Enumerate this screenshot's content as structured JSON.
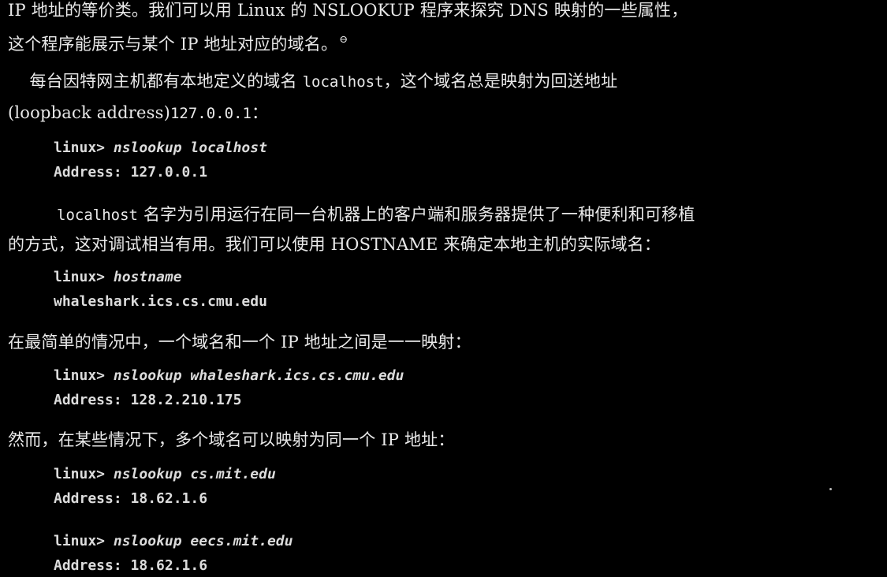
{
  "paragraph_1": {
    "line_1": "IP 地址的等价类。我们可以用 Linux 的 NSLOOKUP 程序来探究 DNS 映射的一些属性，",
    "line_2": "这个程序能展示与某个 IP 地址对应的域名。",
    "footnote_marker": "⊖"
  },
  "paragraph_2": {
    "line_1_prefix": "    每台因特网主机都有本地定义的域名 ",
    "line_1_code": "localhost",
    "line_1_suffix": "，这个域名总是映射为回送地址",
    "line_2_prefix": "(loopback address)",
    "line_2_code": "127.0.0.1",
    "line_2_suffix": "："
  },
  "code_1": {
    "prompt": "linux>",
    "command": "nslookup localhost",
    "output": "Address: 127.0.0.1"
  },
  "paragraph_3": {
    "line_1_code": "localhost",
    "line_1_rest": " 名字为引用运行在同一台机器上的客户端和服务器提供了一种便利和可移植",
    "line_2": "的方式，这对调试相当有用。我们可以使用 HOSTNAME 来确定本地主机的实际域名："
  },
  "code_2": {
    "prompt": "linux>",
    "command": "hostname",
    "output": "whaleshark.ics.cs.cmu.edu"
  },
  "paragraph_4": {
    "line_1": "在最简单的情况中，一个域名和一个 IP 地址之间是一一映射："
  },
  "code_3": {
    "prompt": "linux>",
    "command": "nslookup whaleshark.ics.cs.cmu.edu",
    "output": "Address: 128.2.210.175"
  },
  "paragraph_5": {
    "line_1": "然而，在某些情况下，多个域名可以映射为同一个 IP 地址："
  },
  "code_4": {
    "prompt": "linux>",
    "command": "nslookup cs.mit.edu",
    "output": "Address: 18.62.1.6"
  },
  "code_5": {
    "prompt": "linux>",
    "command": "nslookup eecs.mit.edu",
    "output": "Address: 18.62.1.6"
  }
}
